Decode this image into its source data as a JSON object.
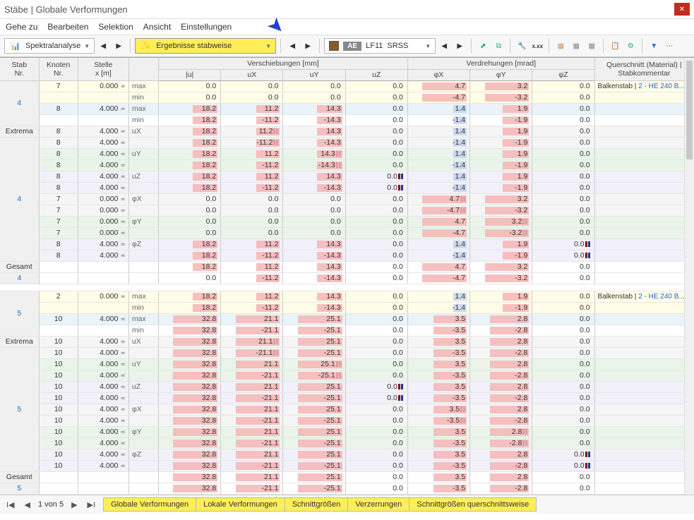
{
  "window": {
    "title": "Stäbe | Globale Verformungen"
  },
  "menu": [
    "Gehe zu",
    "Bearbeiten",
    "Selektion",
    "Ansicht",
    "Einstellungen"
  ],
  "toolbar": {
    "analysis": "Spektralanalyse",
    "results": "Ergebnisse stabweise",
    "ae": "AE",
    "lf": "LF11",
    "comb": "SRSS"
  },
  "headers": {
    "stab": "Stab\nNr.",
    "knoten": "Knoten\nNr.",
    "stelle": "Stelle\nx [m]",
    "versch": "Verschiebungen [mm]",
    "verdr": "Verdrehungen [mrad]",
    "quer": "Querschnitt (Material) |\nStabkommentar",
    "cols": [
      "|u|",
      "uX",
      "uY",
      "uZ",
      "φX",
      "φY",
      "φZ"
    ],
    "extrema": "Extrema",
    "gesamt": "Gesamt"
  },
  "querschnitt": {
    "label": "Balkenstab",
    "link": "2 - HE 240 B..."
  },
  "groups": [
    {
      "stab": "4",
      "block1": [
        {
          "knoten": "7",
          "x": "0.000",
          "lbl": "max",
          "v": [
            0.0,
            0.0,
            0.0,
            0.0,
            4.7,
            3.2,
            0.0
          ],
          "row": "yellow",
          "hilite": [
            4,
            5
          ],
          "q": true
        },
        {
          "lbl": "min",
          "v": [
            0.0,
            0.0,
            0.0,
            0.0,
            -4.7,
            -3.2,
            0.0
          ],
          "row": "yellow"
        },
        {
          "knoten": "8",
          "x": "4.000",
          "lbl": "max",
          "v": [
            18.2,
            11.2,
            14.3,
            0.0,
            1.4,
            1.9,
            0.0
          ],
          "row": "lightblue",
          "hilite": [
            0,
            1,
            2,
            5,
            6
          ]
        },
        {
          "lbl": "min",
          "v": [
            18.2,
            -11.2,
            -14.3,
            0.0,
            -1.4,
            -1.9,
            0.0
          ],
          "row": ""
        }
      ],
      "extrema_id": "4",
      "extrema": [
        {
          "knoten": "8",
          "x": "4.000",
          "lbl": "uX",
          "v": [
            18.2,
            11.2,
            14.3,
            0.0,
            1.4,
            1.9,
            0.0
          ],
          "row": "grey",
          "mk": [
            1
          ]
        },
        {
          "knoten": "8",
          "x": "4.000",
          "lbl": "",
          "v": [
            18.2,
            -11.2,
            -14.3,
            0.0,
            -1.4,
            -1.9,
            0.0
          ],
          "row": "grey",
          "mk": [
            1
          ]
        },
        {
          "knoten": "8",
          "x": "4.000",
          "lbl": "uY",
          "v": [
            18.2,
            11.2,
            14.3,
            0.0,
            1.4,
            1.9,
            0.0
          ],
          "row": "green",
          "mk": [
            2
          ]
        },
        {
          "knoten": "8",
          "x": "4.000",
          "lbl": "",
          "v": [
            18.2,
            -11.2,
            -14.3,
            0.0,
            -1.4,
            -1.9,
            0.0
          ],
          "row": "green",
          "mk": [
            2
          ]
        },
        {
          "knoten": "8",
          "x": "4.000",
          "lbl": "uZ",
          "v": [
            18.2,
            11.2,
            14.3,
            0.0,
            1.4,
            1.9,
            0.0
          ],
          "row": "lilac",
          "mk": [
            3
          ]
        },
        {
          "knoten": "8",
          "x": "4.000",
          "lbl": "",
          "v": [
            18.2,
            -11.2,
            -14.3,
            0.0,
            -1.4,
            -1.9,
            0.0
          ],
          "row": "lilac",
          "mk": [
            3
          ]
        },
        {
          "knoten": "7",
          "x": "0.000",
          "lbl": "φX",
          "v": [
            0.0,
            0.0,
            0.0,
            0.0,
            4.7,
            3.2,
            0.0
          ],
          "row": "grey",
          "mk": [
            4
          ]
        },
        {
          "knoten": "7",
          "x": "0.000",
          "lbl": "",
          "v": [
            0.0,
            0.0,
            0.0,
            0.0,
            -4.7,
            -3.2,
            0.0
          ],
          "row": "grey",
          "mk": [
            4
          ]
        },
        {
          "knoten": "7",
          "x": "0.000",
          "lbl": "φY",
          "v": [
            0.0,
            0.0,
            0.0,
            0.0,
            4.7,
            3.2,
            0.0
          ],
          "row": "green",
          "mk": [
            5
          ]
        },
        {
          "knoten": "7",
          "x": "0.000",
          "lbl": "",
          "v": [
            0.0,
            0.0,
            0.0,
            0.0,
            -4.7,
            -3.2,
            0.0
          ],
          "row": "green",
          "mk": [
            5
          ]
        },
        {
          "knoten": "8",
          "x": "4.000",
          "lbl": "φZ",
          "v": [
            18.2,
            11.2,
            14.3,
            0.0,
            1.4,
            1.9,
            0.0
          ],
          "row": "lilac",
          "mk": [
            6
          ]
        },
        {
          "knoten": "8",
          "x": "4.000",
          "lbl": "",
          "v": [
            18.2,
            -11.2,
            -14.3,
            0.0,
            -1.4,
            -1.9,
            0.0
          ],
          "row": "lilac",
          "mk": [
            6
          ]
        }
      ],
      "gesamt_id": "4",
      "gesamt": [
        {
          "v": [
            18.2,
            11.2,
            14.3,
            0.0,
            4.7,
            3.2,
            0.0
          ],
          "row": ""
        },
        {
          "v": [
            0.0,
            -11.2,
            -14.3,
            0.0,
            -4.7,
            -3.2,
            0.0
          ],
          "row": ""
        }
      ]
    },
    {
      "stab": "5",
      "block1": [
        {
          "knoten": "2",
          "x": "0.000",
          "lbl": "max",
          "v": [
            18.2,
            11.2,
            14.3,
            0.0,
            1.4,
            1.9,
            0.0
          ],
          "row": "yellow",
          "q": true
        },
        {
          "lbl": "min",
          "v": [
            18.2,
            -11.2,
            -14.3,
            0.0,
            -1.4,
            -1.9,
            0.0
          ],
          "row": "yellow"
        },
        {
          "knoten": "10",
          "x": "4.000",
          "lbl": "max",
          "v": [
            32.8,
            21.1,
            25.1,
            0.0,
            3.5,
            2.8,
            0.0
          ],
          "row": "lightblue"
        },
        {
          "lbl": "min",
          "v": [
            32.8,
            -21.1,
            -25.1,
            0.0,
            -3.5,
            -2.8,
            0.0
          ],
          "row": ""
        }
      ],
      "extrema_id": "5",
      "extrema": [
        {
          "knoten": "10",
          "x": "4.000",
          "lbl": "uX",
          "v": [
            32.8,
            21.1,
            25.1,
            0.0,
            3.5,
            2.8,
            0.0
          ],
          "row": "grey",
          "mk": [
            1
          ]
        },
        {
          "knoten": "10",
          "x": "4.000",
          "lbl": "",
          "v": [
            32.8,
            -21.1,
            -25.1,
            0.0,
            -3.5,
            -2.8,
            0.0
          ],
          "row": "grey",
          "mk": [
            1
          ]
        },
        {
          "knoten": "10",
          "x": "4.000",
          "lbl": "uY",
          "v": [
            32.8,
            21.1,
            25.1,
            0.0,
            3.5,
            2.8,
            0.0
          ],
          "row": "green",
          "mk": [
            2
          ]
        },
        {
          "knoten": "10",
          "x": "4.000",
          "lbl": "",
          "v": [
            32.8,
            -21.1,
            -25.1,
            0.0,
            -3.5,
            -2.8,
            0.0
          ],
          "row": "green",
          "mk": [
            2
          ]
        },
        {
          "knoten": "10",
          "x": "4.000",
          "lbl": "uZ",
          "v": [
            32.8,
            21.1,
            25.1,
            0.0,
            3.5,
            2.8,
            0.0
          ],
          "row": "lilac",
          "mk": [
            3
          ]
        },
        {
          "knoten": "10",
          "x": "4.000",
          "lbl": "",
          "v": [
            32.8,
            -21.1,
            -25.1,
            0.0,
            -3.5,
            -2.8,
            0.0
          ],
          "row": "lilac",
          "mk": [
            3
          ]
        },
        {
          "knoten": "10",
          "x": "4.000",
          "lbl": "φX",
          "v": [
            32.8,
            21.1,
            25.1,
            0.0,
            3.5,
            2.8,
            0.0
          ],
          "row": "grey",
          "mk": [
            4
          ]
        },
        {
          "knoten": "10",
          "x": "4.000",
          "lbl": "",
          "v": [
            32.8,
            -21.1,
            -25.1,
            0.0,
            -3.5,
            -2.8,
            0.0
          ],
          "row": "grey",
          "mk": [
            4
          ]
        },
        {
          "knoten": "10",
          "x": "4.000",
          "lbl": "φY",
          "v": [
            32.8,
            21.1,
            25.1,
            0.0,
            3.5,
            2.8,
            0.0
          ],
          "row": "green",
          "mk": [
            5
          ]
        },
        {
          "knoten": "10",
          "x": "4.000",
          "lbl": "",
          "v": [
            32.8,
            -21.1,
            -25.1,
            0.0,
            -3.5,
            -2.8,
            0.0
          ],
          "row": "green",
          "mk": [
            5
          ]
        },
        {
          "knoten": "10",
          "x": "4.000",
          "lbl": "φZ",
          "v": [
            32.8,
            21.1,
            25.1,
            0.0,
            3.5,
            2.8,
            0.0
          ],
          "row": "lilac",
          "mk": [
            6
          ]
        },
        {
          "knoten": "10",
          "x": "4.000",
          "lbl": "",
          "v": [
            32.8,
            -21.1,
            -25.1,
            0.0,
            -3.5,
            -2.8,
            0.0
          ],
          "row": "lilac",
          "mk": [
            6
          ]
        }
      ],
      "gesamt_id": "5",
      "gesamt": [
        {
          "v": [
            32.8,
            21.1,
            25.1,
            0.0,
            3.5,
            2.8,
            0.0
          ],
          "row": ""
        },
        {
          "v": [
            32.8,
            -21.1,
            -25.1,
            0.0,
            -3.5,
            -2.8,
            0.0
          ],
          "row": ""
        }
      ]
    }
  ],
  "maxabs": [
    32.8,
    21.1,
    25.1,
    1,
    4.7,
    3.2,
    1
  ],
  "footer": {
    "page": "1 von 5",
    "tabs": [
      "Globale Verformungen",
      "Lokale Verformungen",
      "Schnittgrößen",
      "Verzerrungen",
      "Schnittgrößen querschnittsweise"
    ]
  }
}
